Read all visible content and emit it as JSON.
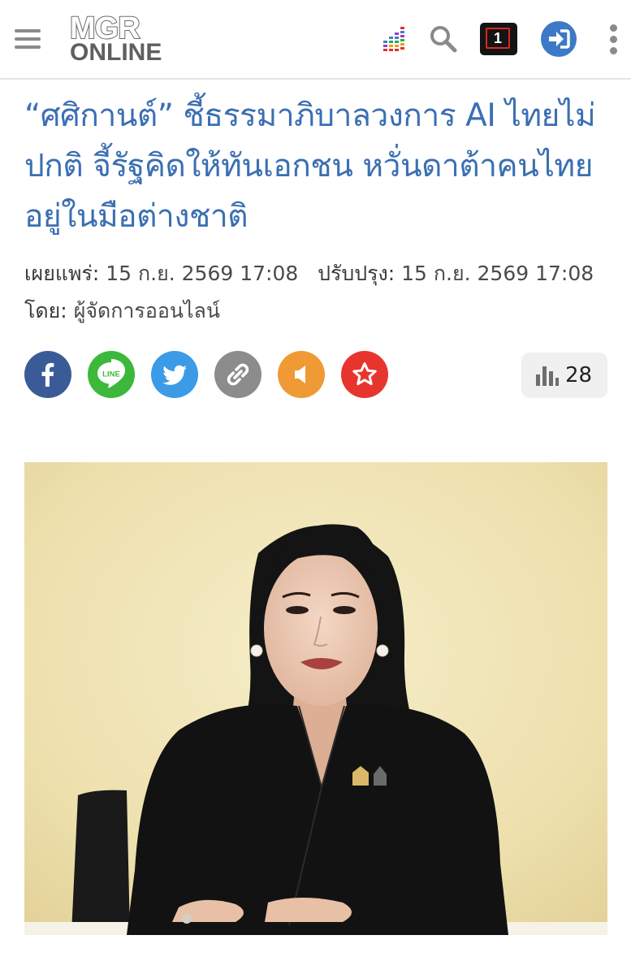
{
  "header": {
    "logo_line1": "MGR",
    "logo_line2": "ONLINE",
    "badge_text": "1"
  },
  "article": {
    "title": "“ศศิกานต์” ชี้ธรรมาภิบาลวงการ AI ไทยไม่ปกติ จี้รัฐคิดให้ทันเอกชน หวั่นดาต้าคนไทยอยู่ในมือต่างชาติ",
    "published_label": "เผยแพร่:",
    "published_value": "15 ก.ย. 2569 17:08",
    "updated_label": "ปรับปรุง:",
    "updated_value": "15 ก.ย. 2569 17:08",
    "author_label": "โดย:",
    "author_value": "ผู้จัดการออนไลน์",
    "view_count": "28"
  },
  "share": {
    "line_text": "LINE"
  },
  "icons": [
    "menu-icon",
    "equalizer-icon",
    "search-icon",
    "login-icon",
    "more-vertical-icon",
    "facebook-icon",
    "line-icon",
    "twitter-icon",
    "link-icon",
    "speaker-icon",
    "star-icon",
    "bar-chart-icon"
  ],
  "colors": {
    "headline": "#3b6fb3",
    "facebook": "#3b5b98",
    "line": "#3cb83b",
    "twitter": "#3b9be6",
    "link": "#8c8c8c",
    "speaker": "#ef9a34",
    "favorite": "#e7352e",
    "login": "#3d79c6"
  }
}
